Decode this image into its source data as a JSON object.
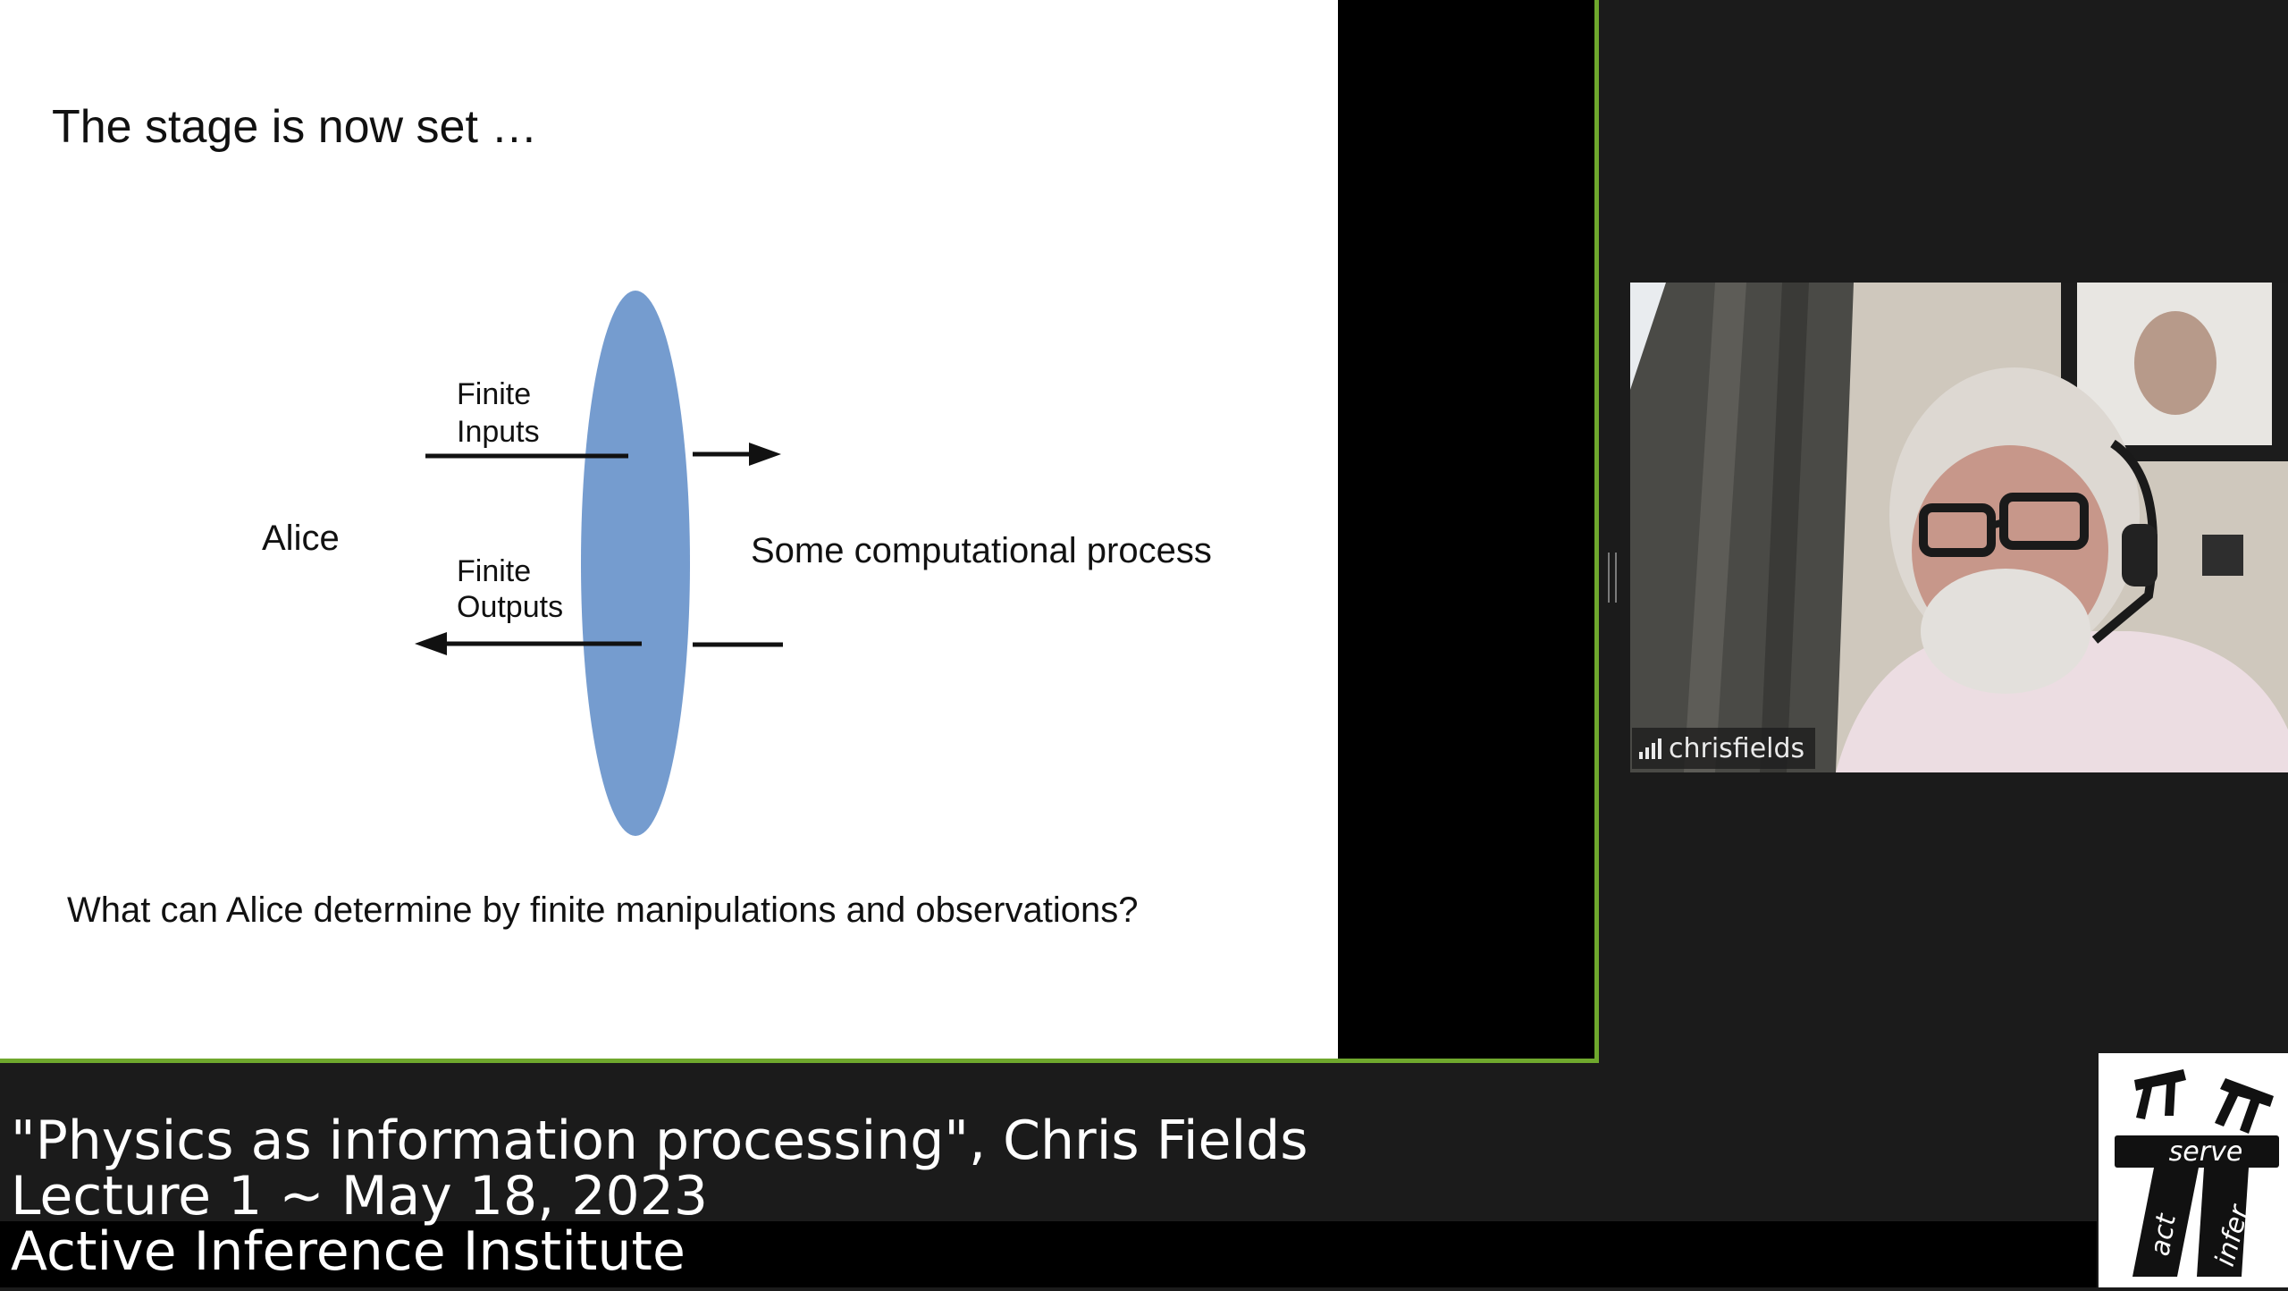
{
  "slide": {
    "title": "The stage is now set …",
    "labels": {
      "alice": "Alice",
      "inputs_line1": "Finite",
      "inputs_line2": "Inputs",
      "outputs_line1": "Finite",
      "outputs_line2": "Outputs",
      "process": "Some computational process"
    },
    "question": "What can Alice determine by finite manipulations and observations?",
    "colors": {
      "lens": "#759ccf",
      "text": "#111111",
      "background": "#ffffff"
    }
  },
  "participant": {
    "name": "chrisfields",
    "icon": "signal-strength-icon"
  },
  "caption": {
    "title_line": "\"Physics as information processing\", Chris Fields",
    "lecture_line": "Lecture 1 ~ May 18, 2023",
    "org_line": "Active Inference Institute"
  },
  "logo": {
    "words": [
      "serve",
      "act",
      "infer"
    ],
    "icon": "active-inference-logo-icon"
  },
  "colors": {
    "active_speaker_border": "#6fa82d",
    "app_background": "#1b1b1b"
  }
}
